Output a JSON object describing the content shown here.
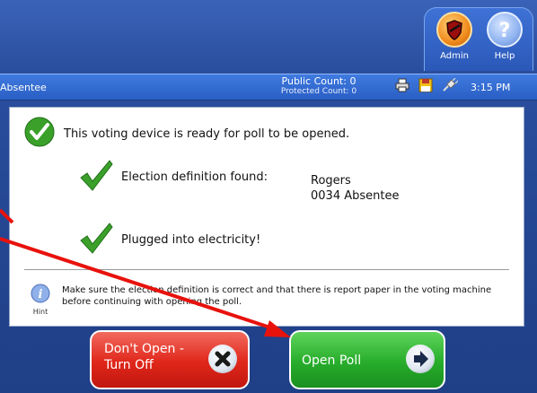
{
  "toolbar": {
    "admin_label": "Admin",
    "help_label": "Help",
    "admin_icon": "shield-icon",
    "help_icon": "question-mark-icon"
  },
  "status_bar": {
    "mode": "Absentee",
    "public_count": "Public Count: 0",
    "protected_count": "Protected Count: 0",
    "icons": [
      "printer-icon",
      "floppy-disk-icon",
      "power-plug-icon"
    ],
    "time": "3:15 PM"
  },
  "panel": {
    "ready_message": "This voting device is ready for poll to be opened.",
    "election_label": "Election definition found:",
    "election_name": "Rogers",
    "election_precinct": "0034 Absentee",
    "electricity_label": "Plugged into electricity!",
    "hint_label": "Hint",
    "hint_text": "Make sure the election definition is correct and that there is report paper in the voting machine before continuing with opening the poll."
  },
  "buttons": {
    "dont_open_line1": "Don't Open -",
    "dont_open_line2": "Turn Off",
    "open_poll": "Open Poll"
  },
  "colors": {
    "background": "#2a4e9e",
    "status_bar": "#2a5fc4",
    "check_green": "#3aa02a",
    "dont_open_red": "#e0261a",
    "open_poll_green": "#27ad2b",
    "annotation_arrow": "#e8120c"
  }
}
